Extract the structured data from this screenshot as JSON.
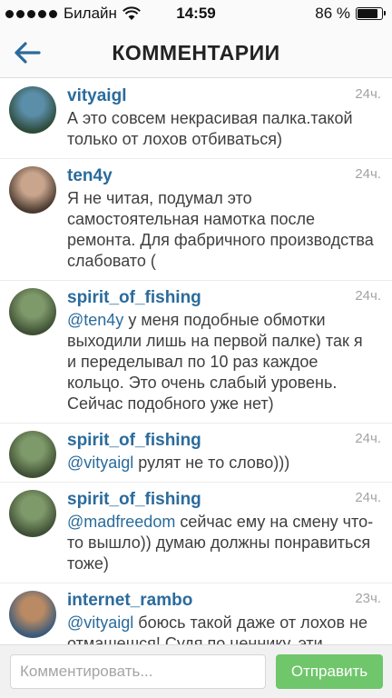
{
  "status_bar": {
    "carrier": "Билайн",
    "time": "14:59",
    "battery_percent": "86 %",
    "battery_level": 0.86
  },
  "header": {
    "title": "КОММЕНТАРИИ",
    "back_icon": "back-arrow-icon"
  },
  "comments": [
    {
      "username": "vityaigl",
      "time": "24ч.",
      "mention": "",
      "text": "А это совсем некрасивая палка.такой только от лохов отбиваться)",
      "avatar_colors": [
        "#5b8ea8",
        "#2d4a3a"
      ]
    },
    {
      "username": "ten4y",
      "time": "24ч.",
      "mention": "",
      "text": "Я не читая, подумал это самостоятельная намотка после ремонта. Для фабричного производства слабовато (",
      "avatar_colors": [
        "#c9a58d",
        "#4a3a30"
      ]
    },
    {
      "username": "spirit_of_fishing",
      "time": "24ч.",
      "mention": "@ten4y",
      "text": " у меня подобные обмотки выходили лишь на первой палке) так я и переделывал по 10 раз каждое кольцо. Это очень слабый уровень. Сейчас подобного уже нет)",
      "avatar_colors": [
        "#7f9a6a",
        "#3f4f35"
      ]
    },
    {
      "username": "spirit_of_fishing",
      "time": "24ч.",
      "mention": "@vityaigl",
      "text": " рулят не то слово)))",
      "avatar_colors": [
        "#7f9a6a",
        "#3f4f35"
      ]
    },
    {
      "username": "spirit_of_fishing",
      "time": "24ч.",
      "mention": "@madfreedom",
      "text": " сейчас ему на смену что-то вышло)) думаю должны понравиться тоже)",
      "avatar_colors": [
        "#7f9a6a",
        "#3f4f35"
      ]
    },
    {
      "username": "internet_rambo",
      "time": "23ч.",
      "mention": "@vityaigl",
      "text": " боюсь такой даже от лохов не отмашешся! Судя по ценнику, эти",
      "avatar_colors": [
        "#b98a63",
        "#3b5a7a"
      ]
    }
  ],
  "composer": {
    "placeholder": "Комментировать...",
    "value": "",
    "send_label": "Отправить",
    "send_color": "#6fc66b"
  },
  "colors": {
    "username": "#2a6b9c",
    "timestamp": "#a3a3a3",
    "text": "#3f3f3f"
  }
}
